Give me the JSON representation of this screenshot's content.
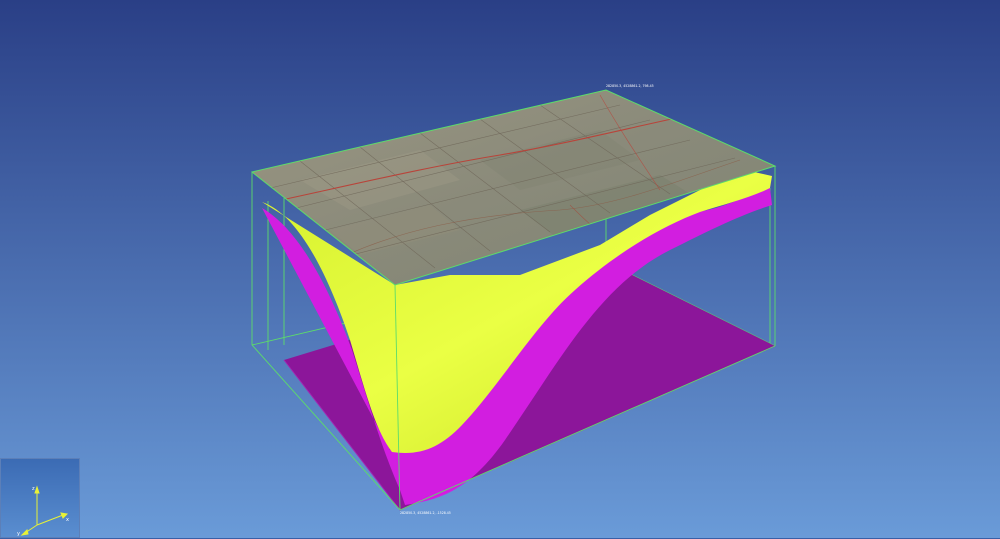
{
  "viewer": {
    "colors": {
      "background_top": "#2a3f86",
      "background_bottom": "#6a9bd8",
      "bounding_box": "#5cdc6a",
      "top_surface": "#e4ff3a",
      "bottom_surface": "#d21ee0",
      "base_plane": "#8c169a",
      "map_tint": "#8b8a78",
      "road": "#b8443a"
    },
    "top_corner_label": "282850.3, 4528861.2, 798.45",
    "bottom_corner_label": "282850.3, 4528861.2, -1528.45",
    "layers": [
      "basemap",
      "upper-horizon",
      "lower-horizon",
      "base-plane"
    ],
    "axis_widget": {
      "icon": "xyz-axes-icon",
      "axis_color": "#e8f236",
      "labels": {
        "x": "x",
        "y": "y",
        "z": "z"
      }
    }
  }
}
